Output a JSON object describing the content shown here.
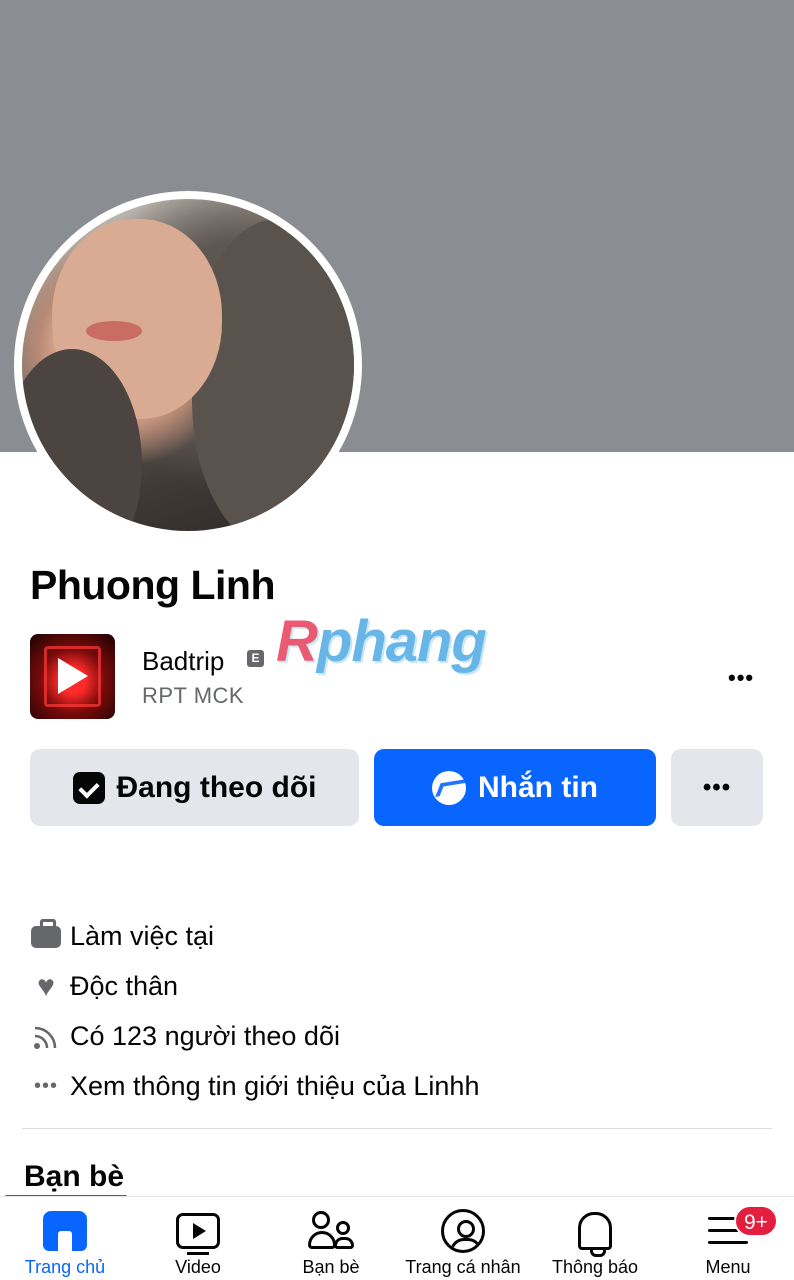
{
  "profile": {
    "name": "Phuong Linh",
    "watermark_r": "R",
    "watermark_rest": "phang"
  },
  "workplace": {
    "name": "Badtrip",
    "badge": "E",
    "subtitle": "RPT MCK",
    "more": "•••"
  },
  "actions": {
    "follow_label": "Đang theo dõi",
    "message_label": "Nhắn tin",
    "more_label": "•••"
  },
  "intro": {
    "work": "Làm việc tại",
    "relationship": "Độc thân",
    "followers": "Có 123 người theo dõi",
    "see_more": "Xem thông tin giới thiệu của Linhh"
  },
  "friends_section": {
    "title": "Bạn bè"
  },
  "nav": {
    "home": "Trang chủ",
    "video": "Video",
    "friends": "Bạn bè",
    "profile": "Trang cá nhân",
    "notifications": "Thông báo",
    "menu": "Menu",
    "menu_badge": "9+"
  },
  "colors": {
    "accent": "#0866ff",
    "cover": "#8a8d91",
    "badge": "#e41e3f",
    "secondary_text": "#65676b",
    "button_grey": "#e4e6eb"
  },
  "icons": [
    "briefcase-icon",
    "heart-icon",
    "rss-icon",
    "more-dots-icon",
    "messenger-icon",
    "following-check-icon",
    "home-icon",
    "video-icon",
    "friends-icon",
    "profile-icon",
    "bell-icon",
    "menu-icon"
  ]
}
